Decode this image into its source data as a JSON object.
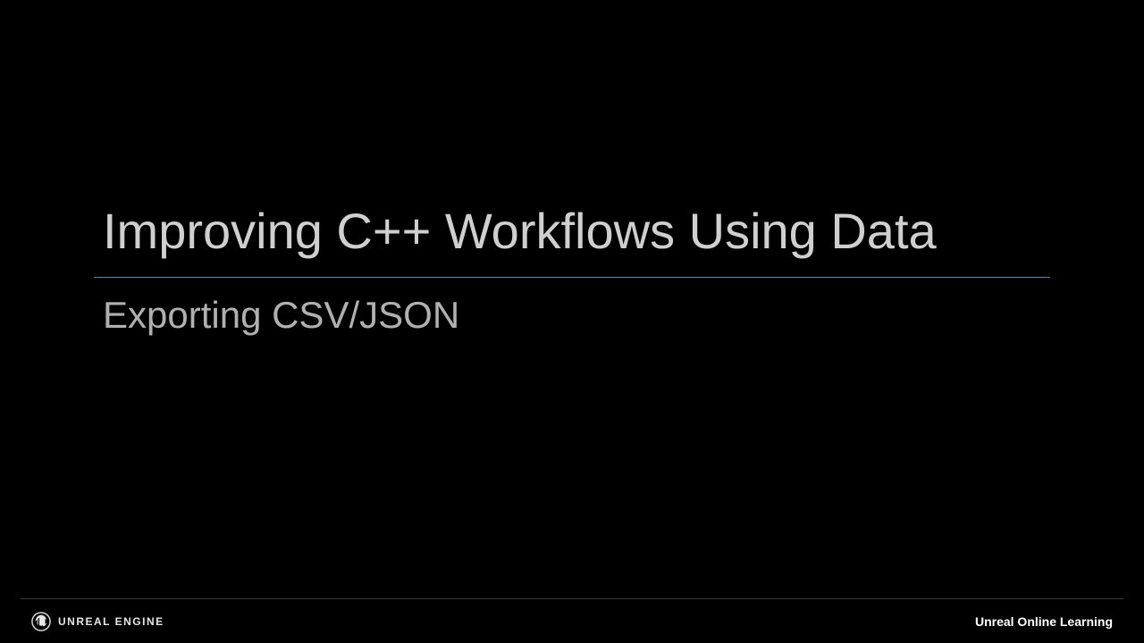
{
  "slide": {
    "title": "Improving C++ Workflows Using Data",
    "subtitle": "Exporting CSV/JSON"
  },
  "footer": {
    "brand": "UNREAL ENGINE",
    "right": "Unreal Online Learning"
  }
}
